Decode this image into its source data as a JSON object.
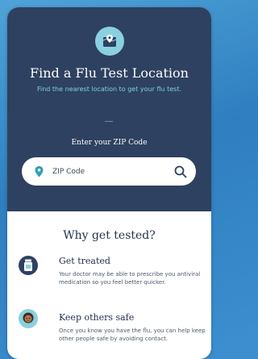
{
  "hero": {
    "title": "Find a Flu Test Location",
    "subtitle": "Find the nearest location to get your flu test.",
    "zip_label": "Enter your ZIP Code"
  },
  "search": {
    "placeholder": "ZIP Code",
    "value": ""
  },
  "why": {
    "heading": "Why get tested?",
    "items": [
      {
        "title": "Get treated",
        "description": "Your doctor may be able to prescribe you antiviral medication so you feel better quicker.",
        "icon": "medicine-bottle-icon"
      },
      {
        "title": "Keep others safe",
        "description": "Once you know you have the flu, you can help keep other people safe by avoiding contact.",
        "icon": "person-avatar-icon"
      }
    ]
  },
  "colors": {
    "hero_bg": "#2e4160",
    "accent_teal": "#7fd0e0",
    "text_dark": "#22324a"
  }
}
